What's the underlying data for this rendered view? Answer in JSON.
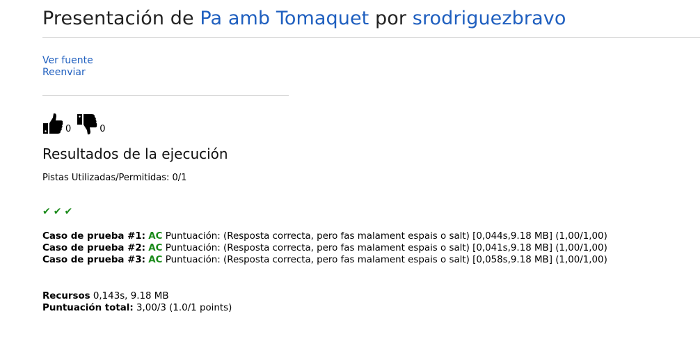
{
  "header": {
    "prefix": "Presentación de",
    "problem": "Pa amb Tomaquet",
    "por": "por",
    "user": "srodriguezbravo"
  },
  "links": {
    "view_source": "Ver fuente",
    "resubmit": "Reenviar"
  },
  "votes": {
    "up_icon": "thumbs-up-icon",
    "down_icon": "thumbs-down-icon",
    "up_count": "0",
    "down_count": "0"
  },
  "results": {
    "heading": "Resultados de la ejecución",
    "hints_label": "Pistas Utilizadas/Permitidas:",
    "hints_value": "0/1",
    "checks": [
      "✔",
      "✔",
      "✔"
    ],
    "check_color": "#1a8a1a",
    "cases": [
      {
        "label": "Caso de prueba #1:",
        "status": "AC",
        "text": "Puntuación: (Resposta correcta, pero fas malament espais o salt) [0,044s,9.18 MB] (1,00/1,00)"
      },
      {
        "label": "Caso de prueba #2:",
        "status": "AC",
        "text": "Puntuación: (Resposta correcta, pero fas malament espais o salt) [0,041s,9.18 MB] (1,00/1,00)"
      },
      {
        "label": "Caso de prueba #3:",
        "status": "AC",
        "text": "Puntuación: (Resposta correcta, pero fas malament espais o salt) [0,058s,9.18 MB] (1,00/1,00)"
      }
    ],
    "resources_label": "Recursos",
    "resources_value": "0,143s, 9.18 MB",
    "total_label": "Puntuación total:",
    "total_value": "3,00/3 (1.0/1 points)"
  },
  "colors": {
    "link": "#1f5fbf",
    "accepted": "#1a8a1a"
  }
}
